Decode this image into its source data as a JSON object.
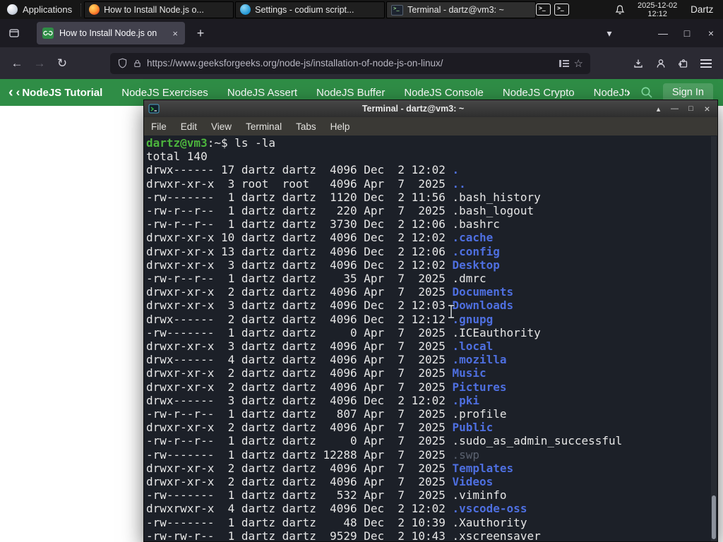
{
  "glyphs": {
    "back": "←",
    "forward": "→",
    "reload": "↻",
    "star": "☆",
    "plus": "+",
    "tabs_chevron": "▾",
    "shade": "▴",
    "minimize": "—",
    "maximize": "□",
    "close": "×",
    "tab_close": "×",
    "chevron_left": "‹",
    "chevron_right": "›"
  },
  "colors": {
    "gfg_green": "#2f8d46",
    "terminal_bg": "#1c2028",
    "prompt_green": "#4cb43d",
    "dir_blue": "#4e6fe0"
  },
  "panel": {
    "applications_label": "Applications",
    "windows": [
      {
        "icon": "firefox",
        "title": "How to Install Node.js o...",
        "active": false
      },
      {
        "icon": "codium",
        "title": "Settings - codium script...",
        "active": false
      },
      {
        "icon": "terminal",
        "title": "Terminal - dartz@vm3: ~",
        "active": true
      }
    ],
    "clock_date": "2025-12-02",
    "clock_time": "12:12",
    "user_label": "Dartz"
  },
  "browser": {
    "tab_title": "How to Install Node.js on",
    "url": "https://www.geeksforgeeks.org/node-js/installation-of-node-js-on-linux/"
  },
  "gfg_nav": {
    "items": [
      {
        "label": "NodeJS Tutorial",
        "bold": true,
        "chevron": true,
        "slug": "tutorial"
      },
      {
        "label": "NodeJS Exercises",
        "slug": "exercises"
      },
      {
        "label": "NodeJS Assert",
        "slug": "assert"
      },
      {
        "label": "NodeJS Buffer",
        "slug": "buffer"
      },
      {
        "label": "NodeJS Console",
        "slug": "console"
      },
      {
        "label": "NodeJS Crypto",
        "slug": "crypto"
      },
      {
        "label": "NodeJS DNS",
        "slug": "dns"
      },
      {
        "label": "Node",
        "slug": "node"
      }
    ],
    "sign_in_label": "Sign In"
  },
  "terminal": {
    "title": "Terminal - dartz@vm3: ~",
    "menus": [
      "File",
      "Edit",
      "View",
      "Terminal",
      "Tabs",
      "Help"
    ],
    "prompt_line": [
      [
        "dartz@vm3",
        "green"
      ],
      [
        ":",
        "fg"
      ],
      [
        "~",
        "fg"
      ],
      [
        "$ ls -la",
        "fg"
      ]
    ],
    "total_line": "total 140",
    "entries": [
      {
        "meta": "drwx------ 17 dartz dartz  4096 Dec  2 12:02 ",
        "name": ".",
        "kind": "dir"
      },
      {
        "meta": "drwxr-xr-x  3 root  root   4096 Apr  7  2025 ",
        "name": "..",
        "kind": "dir"
      },
      {
        "meta": "-rw-------  1 dartz dartz  1120 Dec  2 11:56 ",
        "name": ".bash_history",
        "kind": "fg"
      },
      {
        "meta": "-rw-r--r--  1 dartz dartz   220 Apr  7  2025 ",
        "name": ".bash_logout",
        "kind": "fg"
      },
      {
        "meta": "-rw-r--r--  1 dartz dartz  3730 Dec  2 12:06 ",
        "name": ".bashrc",
        "kind": "fg"
      },
      {
        "meta": "drwxr-xr-x 10 dartz dartz  4096 Dec  2 12:02 ",
        "name": ".cache",
        "kind": "dir"
      },
      {
        "meta": "drwxr-xr-x 13 dartz dartz  4096 Dec  2 12:06 ",
        "name": ".config",
        "kind": "dir"
      },
      {
        "meta": "drwxr-xr-x  3 dartz dartz  4096 Dec  2 12:02 ",
        "name": "Desktop",
        "kind": "dir"
      },
      {
        "meta": "-rw-r--r--  1 dartz dartz    35 Apr  7  2025 ",
        "name": ".dmrc",
        "kind": "fg"
      },
      {
        "meta": "drwxr-xr-x  2 dartz dartz  4096 Apr  7  2025 ",
        "name": "Documents",
        "kind": "dir"
      },
      {
        "meta": "drwxr-xr-x  3 dartz dartz  4096 Dec  2 12:03 ",
        "name": "Downloads",
        "kind": "dir"
      },
      {
        "meta": "drwx------  2 dartz dartz  4096 Dec  2 12:12 ",
        "name": ".gnupg",
        "kind": "dir"
      },
      {
        "meta": "-rw-------  1 dartz dartz     0 Apr  7  2025 ",
        "name": ".ICEauthority",
        "kind": "fg"
      },
      {
        "meta": "drwxr-xr-x  3 dartz dartz  4096 Apr  7  2025 ",
        "name": ".local",
        "kind": "dir"
      },
      {
        "meta": "drwx------  4 dartz dartz  4096 Apr  7  2025 ",
        "name": ".mozilla",
        "kind": "dir"
      },
      {
        "meta": "drwxr-xr-x  2 dartz dartz  4096 Apr  7  2025 ",
        "name": "Music",
        "kind": "dir"
      },
      {
        "meta": "drwxr-xr-x  2 dartz dartz  4096 Apr  7  2025 ",
        "name": "Pictures",
        "kind": "dir"
      },
      {
        "meta": "drwx------  3 dartz dartz  4096 Dec  2 12:02 ",
        "name": ".pki",
        "kind": "dir"
      },
      {
        "meta": "-rw-r--r--  1 dartz dartz   807 Apr  7  2025 ",
        "name": ".profile",
        "kind": "fg"
      },
      {
        "meta": "drwxr-xr-x  2 dartz dartz  4096 Apr  7  2025 ",
        "name": "Public",
        "kind": "dir"
      },
      {
        "meta": "-rw-r--r--  1 dartz dartz     0 Apr  7  2025 ",
        "name": ".sudo_as_admin_successful",
        "kind": "fg"
      },
      {
        "meta": "-rw-------  1 dartz dartz 12288 Apr  7  2025 ",
        "name": ".swp",
        "kind": "dim"
      },
      {
        "meta": "drwxr-xr-x  2 dartz dartz  4096 Apr  7  2025 ",
        "name": "Templates",
        "kind": "dir"
      },
      {
        "meta": "drwxr-xr-x  2 dartz dartz  4096 Apr  7  2025 ",
        "name": "Videos",
        "kind": "dir"
      },
      {
        "meta": "-rw-------  1 dartz dartz   532 Apr  7  2025 ",
        "name": ".viminfo",
        "kind": "fg"
      },
      {
        "meta": "drwxrwxr-x  4 dartz dartz  4096 Dec  2 12:02 ",
        "name": ".vscode-oss",
        "kind": "dir"
      },
      {
        "meta": "-rw-------  1 dartz dartz    48 Dec  2 10:39 ",
        "name": ".Xauthority",
        "kind": "fg"
      },
      {
        "meta": "-rw-rw-r--  1 dartz dartz  9529 Dec  2 10:43 ",
        "name": ".xscreensaver",
        "kind": "fg"
      }
    ]
  }
}
